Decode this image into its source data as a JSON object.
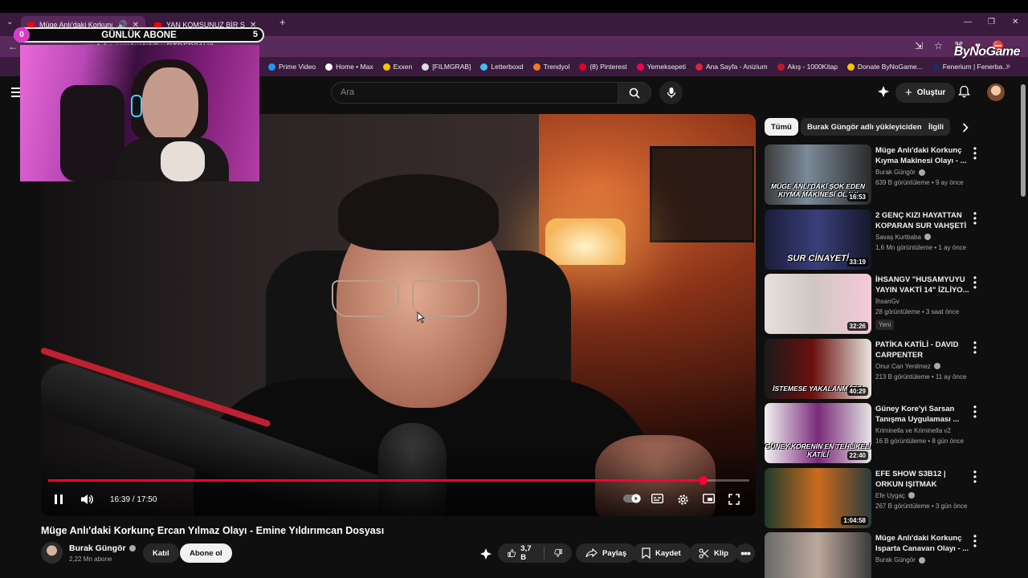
{
  "browser": {
    "tabs": [
      {
        "title": "Müge Anlı'daki Korkunç Er",
        "active": true
      },
      {
        "title": "YAN KOMŞUNUZ BİR SERİ KATİ",
        "active": false
      }
    ],
    "url": "youtube.com/watch?v=DTDFPS1H0",
    "bookmarks": [
      {
        "label": "Prime Video",
        "color": "#1a98ff"
      },
      {
        "label": "Home • Max",
        "color": "#ffffff"
      },
      {
        "label": "Exxen",
        "color": "#f5c400"
      },
      {
        "label": "[FILMGRAB]",
        "color": "#dddddd"
      },
      {
        "label": "Letterboxd",
        "color": "#40bcf4"
      },
      {
        "label": "Trendyol",
        "color": "#f27a1a"
      },
      {
        "label": "(8) Pinterest",
        "color": "#e60023"
      },
      {
        "label": "Yemeksepeti",
        "color": "#fa0050"
      },
      {
        "label": "Ana Sayfa - Anizium",
        "color": "#d9263b"
      },
      {
        "label": "Akış - 1000Kitap",
        "color": "#c4162a"
      },
      {
        "label": "Donate ByNoGame...",
        "color": "#f5c400"
      },
      {
        "label": "Fenerium | Fenerba...",
        "color": "#1c2d5c"
      }
    ]
  },
  "watermark": "ByNoGame",
  "overlay": {
    "counter_left": "0",
    "counter_label": "GÜNLÜK ABONE",
    "counter_right": "5"
  },
  "youtube": {
    "search_placeholder": "Ara",
    "create_label": "Oluştur",
    "video": {
      "title": "Müge Anlı'daki Korkunç Ercan Yılmaz Olayı - Emine Yıldırımcan Dosyası",
      "current_time": "16:39",
      "duration": "17:50",
      "time_display": "16:39 / 17:50",
      "progress_fraction": 0.933
    },
    "channel": {
      "name": "Burak Güngör",
      "subscribers": "2,22 Mn abone",
      "join_label": "Katıl",
      "subscribe_label": "Abone ol"
    },
    "actions": {
      "likes": "3,7 B",
      "share": "Paylaş",
      "save": "Kaydet",
      "clip": "Klip"
    },
    "chips": [
      "Tümü",
      "Burak Güngör adlı yükleyiciden",
      "İlgili"
    ],
    "recommendations": [
      {
        "title": "Müge Anlı'daki Korkunç Kıyma Makinesi Olayı - ...",
        "channel": "Burak Güngör",
        "verified": true,
        "meta": "639 B görüntüleme • 9 ay önce",
        "duration": "16:53",
        "thumb_text": "MÜGE ANLI'DAKİ ŞOK EDEN KIYMA MAKİNESİ OLAYI",
        "badge": ""
      },
      {
        "title": "2 GENÇ KIZI HAYATTAN KOPARAN SUR VAHŞETİ - ...",
        "channel": "Savaş Kurtbaba",
        "verified": true,
        "meta": "1,6 Mn görüntüleme • 1 ay önce",
        "duration": "33:19",
        "thumb_text": "SUR CİNAYETİ",
        "badge": ""
      },
      {
        "title": "İHSANGV \"HUSAMYUYU YAYIN VAKTİ 14\" İZLİYO...",
        "channel": "İhsanGv",
        "verified": false,
        "meta": "28 görüntüleme • 3 saat önce",
        "duration": "32:26",
        "thumb_text": "",
        "badge": "Yeni"
      },
      {
        "title": "PATİKA KATİLİ - DAVID CARPENTER",
        "channel": "Onur Can Yenilmez",
        "verified": true,
        "meta": "213 B görüntüleme • 11 ay önce",
        "duration": "40:29",
        "thumb_text": "İSTEMESE YAKALANMAZDI",
        "badge": ""
      },
      {
        "title": "Güney Kore'yi Sarsan Tanışma Uygulaması ...",
        "channel": "Kriminella ve Kriminella v2",
        "verified": false,
        "meta": "16 B görüntüleme • 8 gün önce",
        "duration": "22:40",
        "thumb_text": "GÜNEY KORENİN EN TEHLİKELİ KATİLİ",
        "badge": ""
      },
      {
        "title": "EFE SHOW S3B12 | ORKUN IŞITMAK",
        "channel": "Efe Uygaç",
        "verified": true,
        "meta": "267 B görüntüleme • 3 gün önce",
        "duration": "1:04:58",
        "thumb_text": "",
        "badge": ""
      },
      {
        "title": "Müge Anlı'daki Korkunç Isparta Canavarı Olayı - ...",
        "channel": "Burak Güngör",
        "verified": true,
        "meta": "",
        "duration": "",
        "thumb_text": "",
        "badge": ""
      }
    ]
  },
  "colors": {
    "accent": "#ff0033",
    "chrome": "#3a1b3d",
    "chrome_light": "#5b2a5d",
    "page_bg": "#0f0f0f"
  }
}
